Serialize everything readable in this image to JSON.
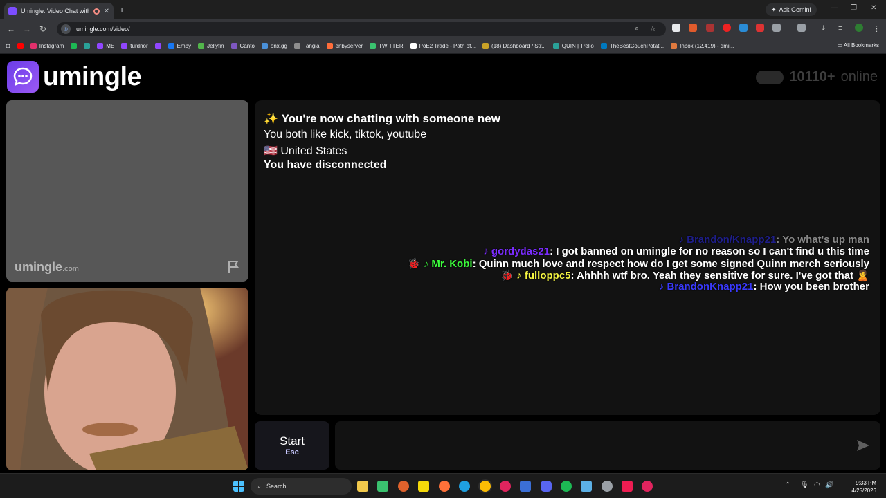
{
  "browser": {
    "tab_title": "Umingle: Video Chat with S",
    "url": "umingle.com/video/",
    "ask_gemini": "Ask Gemini",
    "all_bookmarks": "All Bookmarks",
    "bookmarks": [
      "",
      "Instagram",
      "",
      "",
      "ME",
      "turdnor",
      "",
      "Emby",
      "Jellyfin",
      "Canto",
      "onx.gg",
      "Tangia",
      "enbyserver",
      "TWITTER",
      "PoE2 Trade - Path of...",
      "(18) Dashboard / Str...",
      "QUIN | Trello",
      "TheBestCouchPotat...",
      "Inbox (12,419) - qmi..."
    ],
    "bookmark_colors": [
      "#ff0000",
      "#e1306c",
      "#1db954",
      "#2aa198",
      "#9146ff",
      "#9146ff",
      "#9146ff",
      "#1877f2",
      "#52b54b",
      "#7e57c2",
      "#4a90d9",
      "#8e8e8e",
      "#ff6d3a",
      "#3ac26f",
      "#ffffff",
      "#c9a227",
      "#2aa198",
      "#0079bf",
      "#e07a3f",
      "#d93025"
    ]
  },
  "site": {
    "logo_text": "umingle",
    "online_count": "10110+",
    "online_label": "online",
    "watermark": "umingle",
    "watermark_suffix": ".com"
  },
  "chat": {
    "system": {
      "now_chatting": "✨ You're now chatting with someone new",
      "interests": "You both like kick, tiktok, youtube",
      "country_flag": "🇺🇸",
      "country": "United States",
      "disconnected": "You have disconnected"
    },
    "overlay_messages": [
      {
        "user": "♪ Brandon/Knapp21",
        "text": ": Yo what's up man",
        "user_color": "#1e1e8a",
        "text_color": "#888888"
      },
      {
        "user": "♪ gordydas21",
        "text": ": I got banned on umingle for no reason so I can't find u this time",
        "user_color": "#7b2cff",
        "text_color": "#ffffff"
      },
      {
        "user": "🐞 ♪ Mr. Kobi",
        "text": ": Quinn much love and respect how do I get some signed Quinn merch seriously",
        "user_color": "#3cff3c",
        "text_color": "#ffffff"
      },
      {
        "user": "🐞 ♪ fulloppc5",
        "text": ": Ahhhh wtf bro. Yeah they sensitive for sure. I've got that 🙎",
        "user_color": "#f5f542",
        "text_color": "#ffffff"
      },
      {
        "user": "♪ BrandonKnapp21",
        "text": ": How you been brother",
        "user_color": "#3a3aff",
        "text_color": "#ffffff"
      }
    ]
  },
  "controls": {
    "start_label": "Start",
    "start_shortcut": "Esc",
    "message_placeholder": ""
  },
  "taskbar": {
    "search_label": "Search",
    "time": "9:33 PM",
    "date": "4/25/2026"
  }
}
